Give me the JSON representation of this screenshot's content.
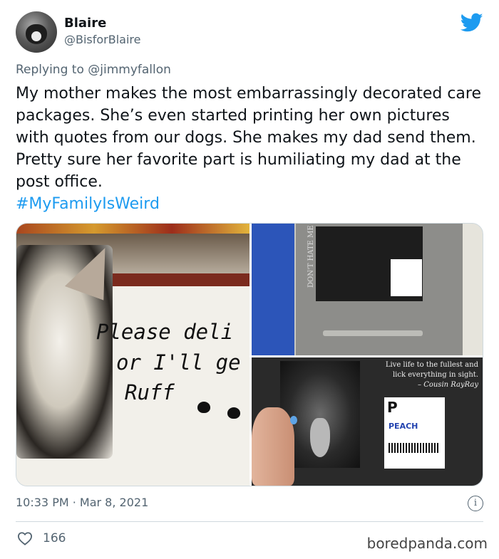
{
  "author": {
    "name": "Blaire",
    "handle": "@BisforBlaire"
  },
  "reply": {
    "prefix": "Replying to ",
    "mention": "@jimmyfallon"
  },
  "tweet": {
    "text": "My mother makes the most embarrassingly decorated care packages. She’s even started printing her own pictures with quotes from our dogs. She makes my dad send them. Pretty sure her favorite part is humiliating my dad at the post office.",
    "hashtag": "#MyFamilyIsWeird",
    "timestamp": "10:33 PM · Mar 8, 2021",
    "likes": "166"
  },
  "media": {
    "note_line1": "Please deli",
    "note_line2": "or I'll ge",
    "note_line3": "Ruff",
    "mailbox_text": "DON'T HATE ME BECAUSE I'M BEAUTIF",
    "quote_line1": "Live life to the fullest and lick everything in sight.",
    "quote_attr": "– Cousin RayRay",
    "postage_letter": "P",
    "postage_name": "PEACH"
  },
  "colors": {
    "accent": "#1d9bf0",
    "secondary_text": "#536471"
  },
  "icons": {
    "brand": "twitter-bird-icon",
    "info": "info-icon",
    "like": "heart-icon"
  },
  "watermark": "boredpanda.com"
}
